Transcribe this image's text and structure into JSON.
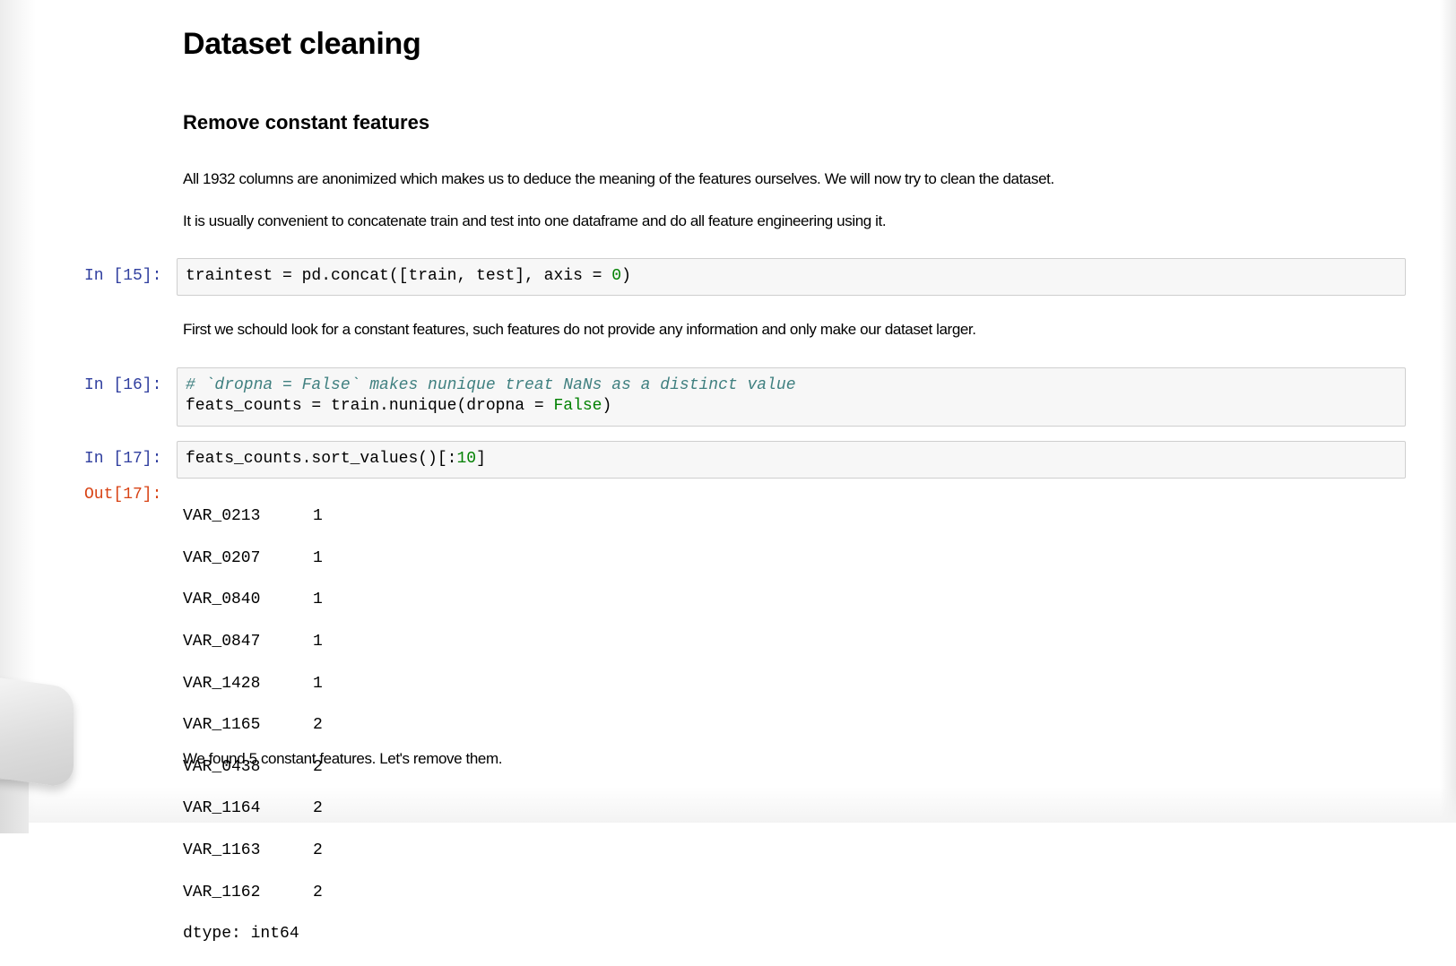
{
  "notebook": {
    "title": "Dataset cleaning",
    "subtitle": "Remove constant features",
    "intro_paragraph_1": "All 1932 columns are anonimized which makes us to deduce the meaning of the features ourselves. We will now try to clean the dataset.",
    "intro_paragraph_2": "It is usually convenient to concatenate train and test into one dataframe and do all feature engineering using it.",
    "cell15": {
      "prompt": "In [15]:",
      "code_a": "traintest = pd.concat([train, test], axis = ",
      "code_num": "0",
      "code_b": ")"
    },
    "middle_paragraph": "First we schould look for a constant features, such features do not provide any information and only make our dataset larger.",
    "cell16": {
      "prompt": "In [16]:",
      "comment": "# `dropna = False` makes nunique treat NaNs as a distinct value",
      "code_a": "feats_counts = train.nunique(dropna = ",
      "code_kw": "False",
      "code_b": ")"
    },
    "cell17": {
      "prompt": "In [17]:",
      "code_a": "feats_counts.sort_values()[:",
      "code_num": "10",
      "code_b": "]",
      "out_prompt": "Out[17]:",
      "output_rows": [
        {
          "name": "VAR_0213",
          "value": "1"
        },
        {
          "name": "VAR_0207",
          "value": "1"
        },
        {
          "name": "VAR_0840",
          "value": "1"
        },
        {
          "name": "VAR_0847",
          "value": "1"
        },
        {
          "name": "VAR_1428",
          "value": "1"
        },
        {
          "name": "VAR_1165",
          "value": "2"
        },
        {
          "name": "VAR_0438",
          "value": "2"
        },
        {
          "name": "VAR_1164",
          "value": "2"
        },
        {
          "name": "VAR_1163",
          "value": "2"
        },
        {
          "name": "VAR_1162",
          "value": "2"
        }
      ],
      "dtype_line": "dtype: int64"
    },
    "closing_paragraph": "We found 5 constant features. Let's remove them."
  }
}
